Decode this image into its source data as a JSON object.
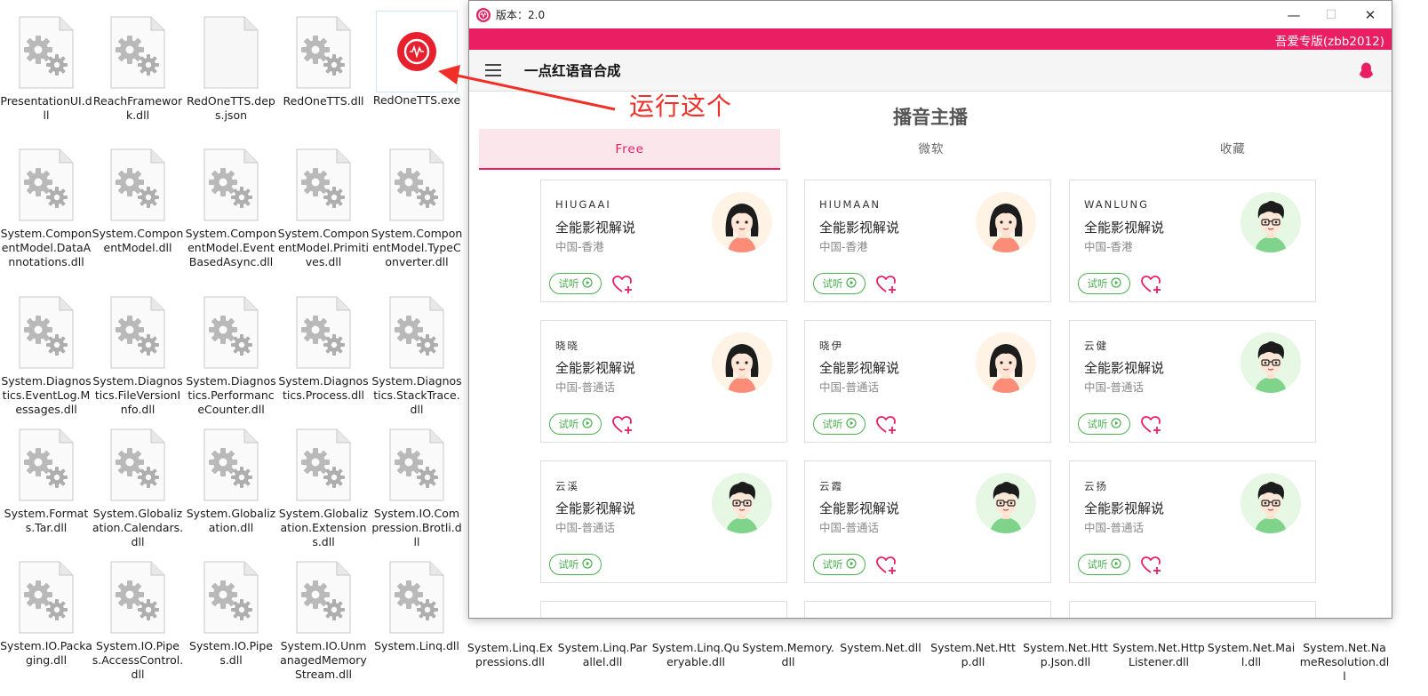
{
  "desktop": {
    "files": [
      {
        "name": "PresentationUI.dll"
      },
      {
        "name": "ReachFramework.dll"
      },
      {
        "name": "RedOneTTS.deps.json"
      },
      {
        "name": "RedOneTTS.dll"
      },
      {
        "name": "RedOneTTS.exe"
      },
      {
        "name": "System.ComponentModel.DataAnnotations.dll"
      },
      {
        "name": "System.ComponentModel.dll"
      },
      {
        "name": "System.ComponentModel.EventBasedAsync.dll"
      },
      {
        "name": "System.ComponentModel.Primitives.dll"
      },
      {
        "name": "System.ComponentModel.TypeConverter.dll"
      },
      {
        "name": "System.Diagnostics.EventLog.Messages.dll"
      },
      {
        "name": "System.Diagnostics.FileVersionInfo.dll"
      },
      {
        "name": "System.Diagnostics.PerformanceCounter.dll"
      },
      {
        "name": "System.Diagnostics.Process.dll"
      },
      {
        "name": "System.Diagnostics.StackTrace.dll"
      },
      {
        "name": "System.Formats.Tar.dll"
      },
      {
        "name": "System.Globalization.Calendars.dll"
      },
      {
        "name": "System.Globalization.dll"
      },
      {
        "name": "System.Globalization.Extensions.dll"
      },
      {
        "name": "System.IO.Compression.Brotli.dll"
      },
      {
        "name": "System.IO.Packaging.dll"
      },
      {
        "name": "System.IO.Pipes.AccessControl.dll"
      },
      {
        "name": "System.IO.Pipes.dll"
      },
      {
        "name": "System.IO.UnmanagedMemoryStream.dll"
      },
      {
        "name": "System.Linq.dll"
      },
      {
        "name": "System.Linq.Expressions.dll"
      },
      {
        "name": "System.Linq.Parallel.dll"
      },
      {
        "name": "System.Linq.Queryable.dll"
      },
      {
        "name": "System.Memory.dll"
      },
      {
        "name": "System.Net.dll"
      },
      {
        "name": "System.Net.Http.dll"
      },
      {
        "name": "System.Net.Http.Json.dll"
      },
      {
        "name": "System.Net.HttpListener.dll"
      },
      {
        "name": "System.Net.Mail.dll"
      },
      {
        "name": "System.Net.NameResolution.dll"
      }
    ]
  },
  "annotation": {
    "text": "运行这个",
    "color": "#f03028"
  },
  "window": {
    "title": "版本：2.0",
    "minimize": "—",
    "maximize": "☐",
    "close": "✕",
    "promo": "吾爱专版(zbb2012)",
    "app_name": "一点红语音合成",
    "section_title": "播音主播",
    "tabs": [
      {
        "label": "Free",
        "active": true
      },
      {
        "label": "微软",
        "active": false
      },
      {
        "label": "收藏",
        "active": false
      }
    ],
    "listen_label": "试听",
    "accent": "#e91e63",
    "green": "#4caf50",
    "cards": [
      {
        "id": "HIUGAAI",
        "style": "全能影视解说",
        "region": "中国-香港",
        "gender": "female"
      },
      {
        "id": "HIUMAAN",
        "style": "全能影视解说",
        "region": "中国-香港",
        "gender": "female"
      },
      {
        "id": "WANLUNG",
        "style": "全能影视解说",
        "region": "中国-香港",
        "gender": "male"
      },
      {
        "id": "晓晓",
        "style": "全能影视解说",
        "region": "中国-普通话",
        "gender": "female"
      },
      {
        "id": "晓伊",
        "style": "全能影视解说",
        "region": "中国-普通话",
        "gender": "female"
      },
      {
        "id": "云健",
        "style": "全能影视解说",
        "region": "中国-普通话",
        "gender": "male"
      },
      {
        "id": "云溪",
        "style": "全能影视解说",
        "region": "中国-普通话",
        "gender": "male"
      },
      {
        "id": "云霞",
        "style": "全能影视解说",
        "region": "中国-普通话",
        "gender": "male"
      },
      {
        "id": "云扬",
        "style": "全能影视解说",
        "region": "中国-普通话",
        "gender": "male"
      }
    ]
  }
}
